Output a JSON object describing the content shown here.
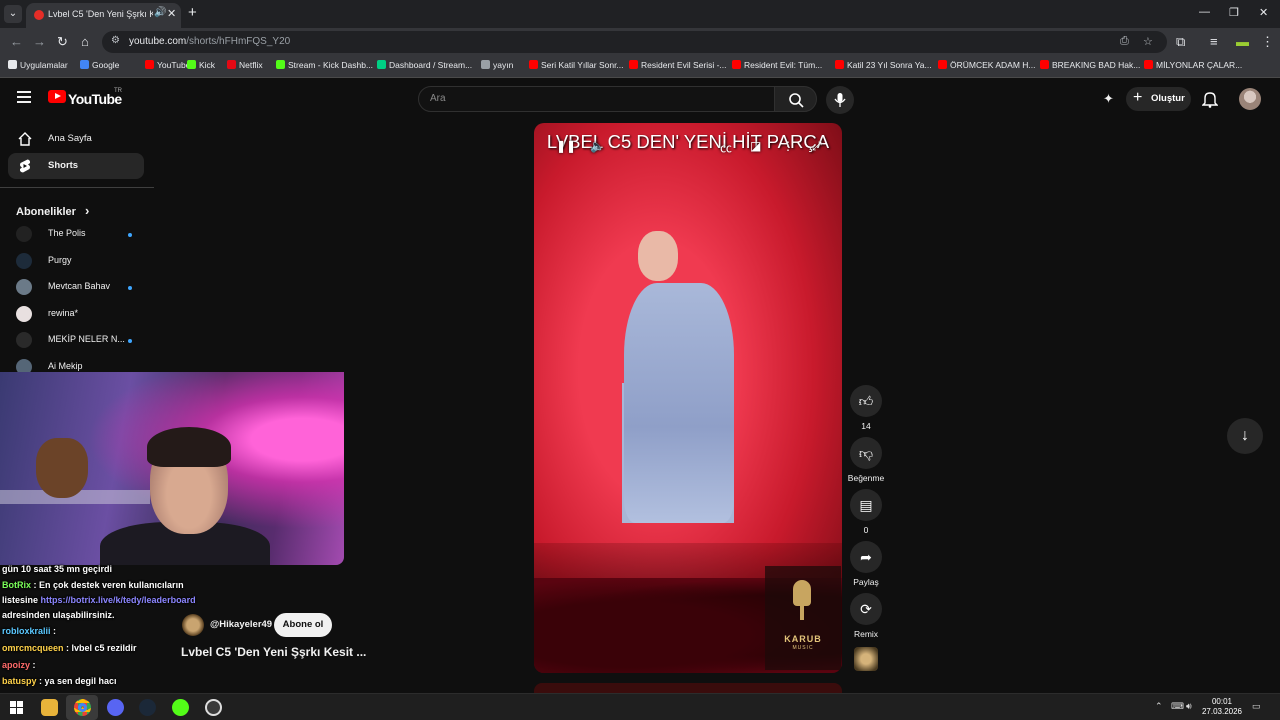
{
  "browser": {
    "tab_title": "Lvbel C5 'Den Yeni Şşrkı Kesit ...",
    "url_domain": "youtube.com",
    "url_path": "/shorts/hFHmFQS_Y20",
    "bookmarks": [
      {
        "label": "Uygulamalar",
        "color": "#e8eaed"
      },
      {
        "label": "Google",
        "color": "#4285f4"
      },
      {
        "label": "YouTube",
        "color": "#ff0000"
      },
      {
        "label": "Kick",
        "color": "#53fc18"
      },
      {
        "label": "Netflix",
        "color": "#e50914"
      },
      {
        "label": "Stream - Kick Dashb...",
        "color": "#53fc18"
      },
      {
        "label": "Dashboard / Stream...",
        "color": "#00d084"
      },
      {
        "label": "yayın",
        "color": "#9aa0a6"
      },
      {
        "label": "Seri Katil Yıllar Sonr...",
        "color": "#ff0000"
      },
      {
        "label": "Resident Evil Serisi -...",
        "color": "#ff0000"
      },
      {
        "label": "Resident Evil: Tüm...",
        "color": "#ff0000"
      },
      {
        "label": "Katil 23 Yıl Sonra Ya...",
        "color": "#ff0000"
      },
      {
        "label": "ÖRÜMCEK ADAM H...",
        "color": "#ff0000"
      },
      {
        "label": "BREAKING BAD Hak...",
        "color": "#ff0000"
      },
      {
        "label": "MİLYONLAR ÇALAR...",
        "color": "#ff0000"
      }
    ]
  },
  "youtube": {
    "wordmark": "YouTube",
    "wordmark_sup": "TR",
    "search_placeholder": "Ara",
    "create_label": "Oluştur",
    "sidebar": {
      "items": [
        {
          "label": "Ana Sayfa",
          "icon": "home-icon"
        },
        {
          "label": "Shorts",
          "icon": "shorts-icon"
        }
      ],
      "subscriptions_header": "Abonelikler",
      "subscriptions_chevron": "›",
      "channels": [
        {
          "label": "The Polis",
          "color": "#222",
          "new": true
        },
        {
          "label": "Purgy",
          "color": "#1d2b3a",
          "new": false
        },
        {
          "label": "Mevtcan Bahav",
          "color": "#6b7a88",
          "new": true
        },
        {
          "label": "rewina*",
          "color": "#e8e0e0",
          "new": false
        },
        {
          "label": "MEKİP NELER N...",
          "color": "#2a2a2a",
          "new": true
        },
        {
          "label": "Ai Mekip",
          "color": "#556677",
          "new": false
        }
      ]
    },
    "short": {
      "caption": "LVBEL C5 DEN' YENİ HİT PARÇA",
      "channel_handle": "@Hikayeler49",
      "subscribe_label": "Abone ol",
      "title": "Lvbel C5 'Den Yeni Şşrkı Kesit ...",
      "watermark_name": "KARUB",
      "watermark_sub": "MUSIC"
    },
    "actions": {
      "like_count": "14",
      "dislike_label": "Beğenme",
      "comment_count": "0",
      "share_label": "Paylaş",
      "remix_label": "Remix"
    }
  },
  "chat": [
    {
      "parts": [
        {
          "t": "gün 10 saat 35 mn geçirdi",
          "c": ""
        }
      ]
    },
    {
      "parts": [
        {
          "t": "BotRix",
          "c": "u-green"
        },
        {
          "t": " : En çok destek veren kullanıcıların",
          "c": ""
        }
      ]
    },
    {
      "parts": [
        {
          "t": "listesine ",
          "c": ""
        },
        {
          "t": "https://botrix.live/k/tedy/leaderboard",
          "c": "link"
        }
      ]
    },
    {
      "parts": [
        {
          "t": "adresinden ulaşabilirsiniz.",
          "c": ""
        }
      ]
    },
    {
      "parts": [
        {
          "t": "robloxkralii",
          "c": "u-blue"
        },
        {
          "t": " : ",
          "c": ""
        }
      ]
    },
    {
      "parts": [
        {
          "t": "omrcmcqueen",
          "c": "u-yellow"
        },
        {
          "t": " : lvbel c5 rezildir",
          "c": ""
        }
      ]
    },
    {
      "parts": [
        {
          "t": "apoizy",
          "c": "u-red"
        },
        {
          "t": " : ",
          "c": ""
        }
      ]
    },
    {
      "parts": [
        {
          "t": "batuspy",
          "c": "u-yellow"
        },
        {
          "t": " : ya sen degil hacı",
          "c": ""
        }
      ]
    }
  ],
  "taskbar": {
    "time": "00:01",
    "date": "27.03.2026"
  }
}
